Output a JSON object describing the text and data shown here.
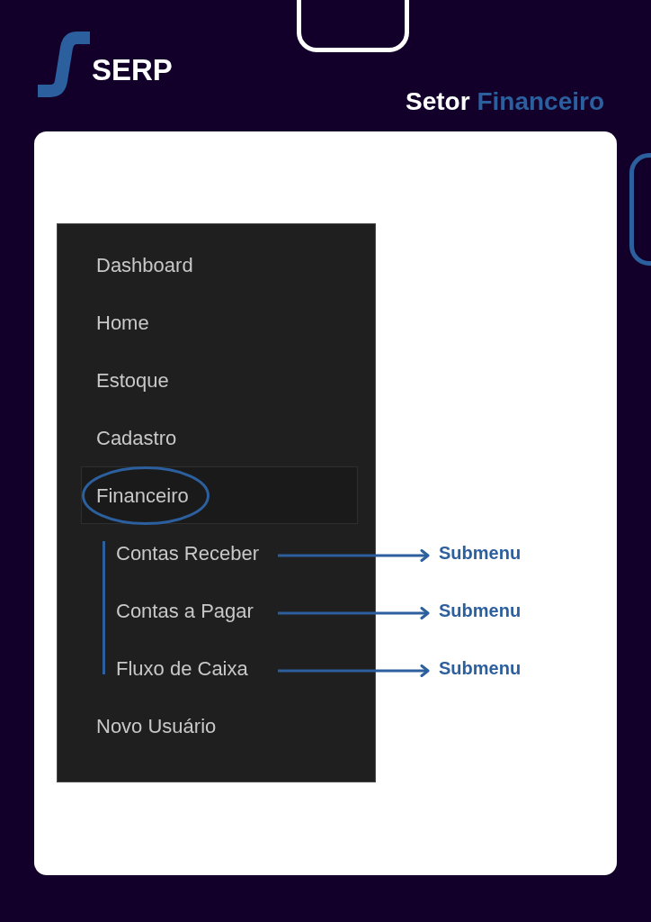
{
  "logo": {
    "text": "SERP"
  },
  "heading": {
    "lead": "Setor",
    "accent": "Financeiro"
  },
  "menu": {
    "items": [
      {
        "label": "Dashboard",
        "selected": false,
        "circled": false
      },
      {
        "label": "Home",
        "selected": false,
        "circled": false
      },
      {
        "label": "Estoque",
        "selected": false,
        "circled": false
      },
      {
        "label": "Cadastro",
        "selected": false,
        "circled": false
      },
      {
        "label": "Financeiro",
        "selected": true,
        "circled": true,
        "children": [
          {
            "label": "Contas Receber",
            "callout": "Submenu"
          },
          {
            "label": "Contas a Pagar",
            "callout": "Submenu"
          },
          {
            "label": "Fluxo de Caixa",
            "callout": "Submenu"
          }
        ]
      },
      {
        "label": "Novo Usuário",
        "selected": false,
        "circled": false
      }
    ]
  }
}
